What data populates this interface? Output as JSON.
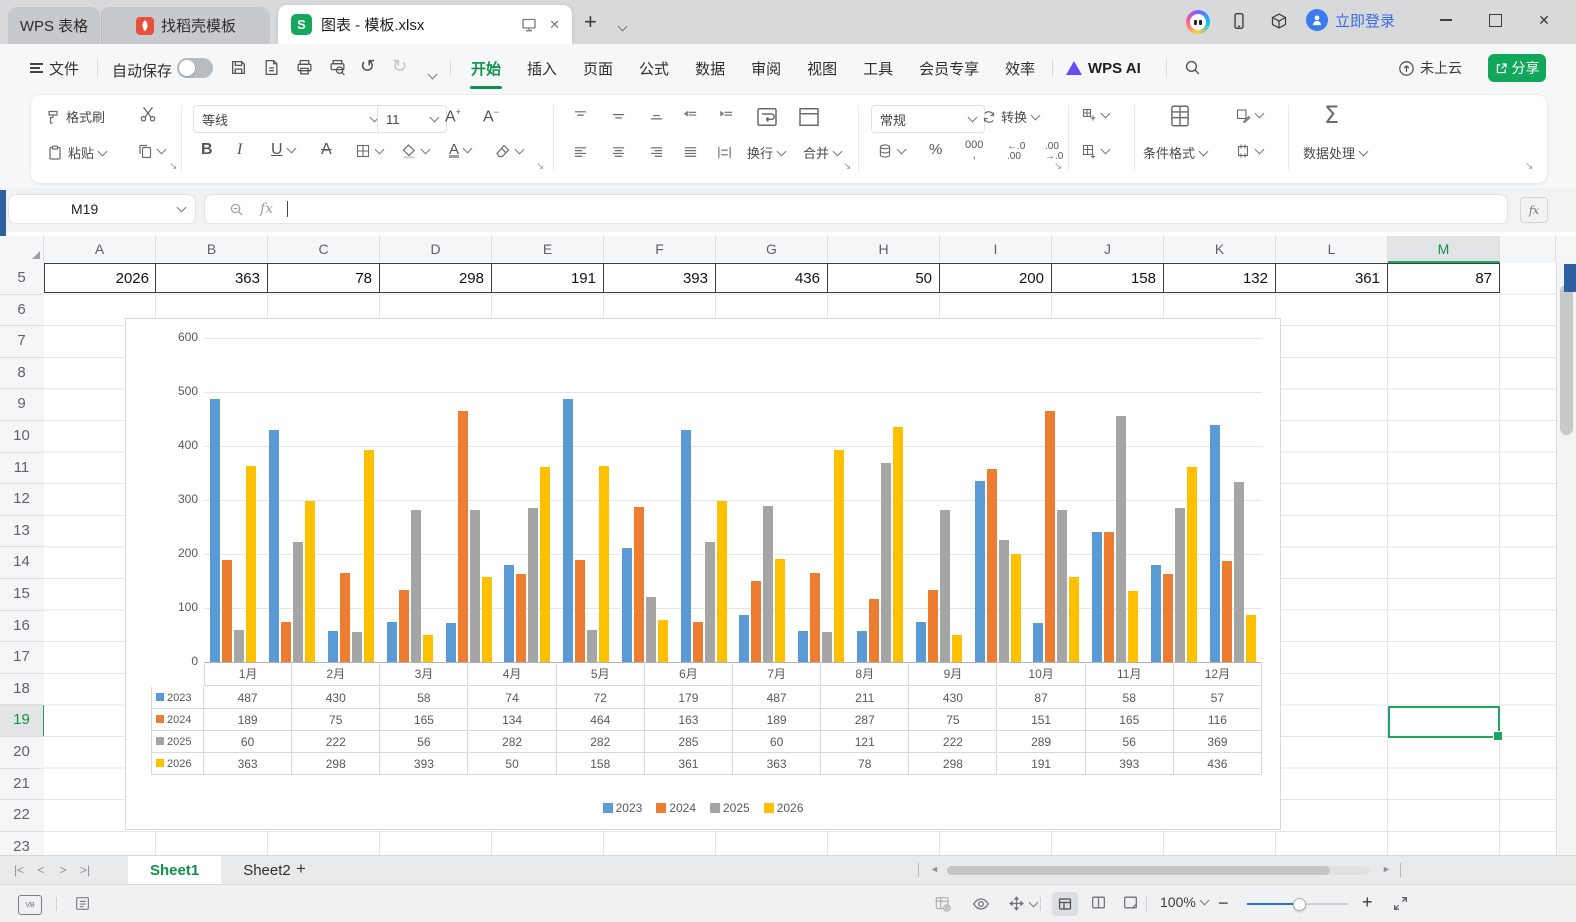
{
  "window": {
    "app_tab": "WPS 表格",
    "template_tab": "找稻壳模板",
    "doc_tab": "图表 - 模板.xlsx",
    "login_text": "立即登录",
    "minimize": "─",
    "maximize": "□",
    "close": "✕",
    "new_tab": "+"
  },
  "menu": {
    "file": "文件",
    "autosave": "自动保存",
    "tabs": [
      "开始",
      "插入",
      "页面",
      "公式",
      "数据",
      "审阅",
      "视图",
      "工具",
      "会员专享",
      "效率"
    ],
    "active_tab": "开始",
    "wps_ai": "WPS AI",
    "not_synced": "未上云",
    "share": "分享"
  },
  "ribbon": {
    "format_painter": "格式刷",
    "paste": "粘贴",
    "font_name": "等线",
    "font_size": "11",
    "grow_font": "A+",
    "shrink_font": "A-",
    "wrap": "换行",
    "merge": "合并",
    "number_format": "常规",
    "convert": "转换",
    "percent": "%",
    "thousands": "000",
    "dec_inc": "←.0",
    "dec_dec": ".00",
    "cond_format": "条件格式",
    "data_process": "数据处理",
    "sigma": "Σ"
  },
  "formula_bar": {
    "cell_ref": "M19",
    "formula": "",
    "fx_label": "fx"
  },
  "grid": {
    "columns": [
      "A",
      "B",
      "C",
      "D",
      "E",
      "F",
      "G",
      "H",
      "I",
      "J",
      "K",
      "L",
      "M"
    ],
    "selected_column": "M",
    "selected_row": 19,
    "selected_cell": "M19",
    "first_row": 5,
    "last_row": 23,
    "row5_values": [
      "2026",
      "363",
      "78",
      "298",
      "191",
      "393",
      "436",
      "50",
      "200",
      "158",
      "132",
      "361",
      "87"
    ]
  },
  "chart_data": {
    "type": "bar",
    "title": "",
    "categories": [
      "1月",
      "2月",
      "3月",
      "4月",
      "5月",
      "6月",
      "7月",
      "8月",
      "9月",
      "10月",
      "11月",
      "12月"
    ],
    "series": [
      {
        "name": "2023",
        "color": "#5B9BD5",
        "values": [
          487,
          430,
          58,
          74,
          72,
          179,
          487,
          211,
          430,
          87,
          58,
          57
        ]
      },
      {
        "name": "2024",
        "color": "#ED7D31",
        "values": [
          189,
          75,
          165,
          134,
          464,
          163,
          189,
          287,
          75,
          151,
          165,
          116
        ]
      },
      {
        "name": "2025",
        "color": "#A5A5A5",
        "values": [
          60,
          222,
          56,
          282,
          282,
          285,
          60,
          121,
          222,
          289,
          56,
          369
        ]
      },
      {
        "name": "2026",
        "color": "#FFC000",
        "values": [
          363,
          298,
          393,
          50,
          158,
          361,
          363,
          78,
          298,
          191,
          393,
          436
        ]
      }
    ],
    "ylim": [
      0,
      600
    ],
    "ytick_step": 100,
    "grid": true,
    "legend": [
      "2023",
      "2024",
      "2025",
      "2026"
    ],
    "legend_position": "bottom",
    "data_table_shown": true,
    "plotted_groups": [
      [
        487,
        189,
        60,
        363
      ],
      [
        430,
        75,
        222,
        298
      ],
      [
        58,
        165,
        56,
        393
      ],
      [
        74,
        134,
        282,
        50
      ],
      [
        72,
        464,
        282,
        158
      ],
      [
        179,
        163,
        285,
        361
      ],
      [
        487,
        189,
        60,
        363
      ],
      [
        211,
        287,
        121,
        78
      ],
      [
        430,
        75,
        222,
        298
      ],
      [
        87,
        151,
        289,
        191
      ],
      [
        58,
        165,
        56,
        393
      ],
      [
        57,
        116,
        369,
        436
      ],
      [
        74,
        134,
        282,
        50
      ],
      [
        335,
        358,
        226,
        200
      ],
      [
        72,
        464,
        282,
        158
      ],
      [
        240,
        240,
        456,
        132
      ],
      [
        179,
        163,
        285,
        361
      ],
      [
        439,
        188,
        334,
        87
      ]
    ],
    "note": "bars render 18 groups across 12 month cells, as in screenshot"
  },
  "sheet_bar": {
    "tabs": [
      "Sheet1",
      "Sheet2"
    ],
    "active_tab": "Sheet1",
    "add_label": "+"
  },
  "status_bar": {
    "zoom": "100%"
  },
  "icons": {
    "doc-icon": "S",
    "search-icon": "magnifier",
    "undo-icon": "↺",
    "redo-icon": "↻",
    "select-all-corner": "◢",
    "scroll-up": "▲",
    "scroll-left": "◄",
    "scroll-right": "►"
  },
  "colors": {
    "accent_green": "#1EA464",
    "menu_green": "#10914e",
    "share_green": "#12A85C",
    "login_blue": "#3B6BE0",
    "series_blue": "#5B9BD5",
    "series_orange": "#ED7D31",
    "series_gray": "#A5A5A5",
    "series_yellow": "#FFC000"
  }
}
